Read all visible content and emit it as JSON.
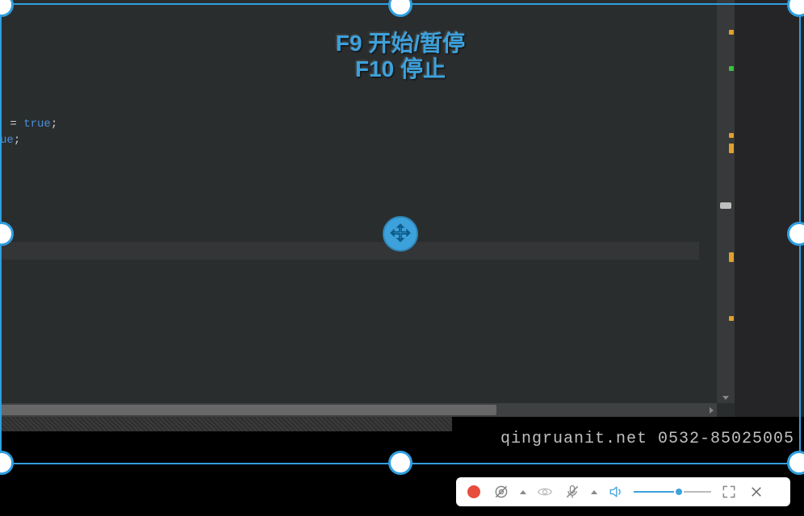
{
  "editor": {
    "line1_eq": " = ",
    "line1_kw": "true",
    "line1_end": ";",
    "line2_frag": "ue",
    "line2_end": ";"
  },
  "hotkeys": {
    "line1": "F9 开始/暂停",
    "line2": "F10 停止"
  },
  "watermark": "qingruanit.net 0532-85025005",
  "toolbar": {
    "volume_percent": 58
  }
}
